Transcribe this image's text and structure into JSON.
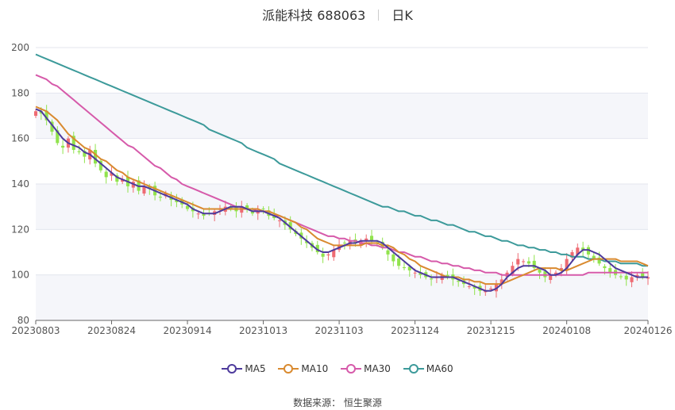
{
  "header": {
    "name_code": "派能科技 688063",
    "period": "日K"
  },
  "source": "数据来源：  恒生聚源",
  "colors": {
    "up": "#ee6b73",
    "down": "#91e34d",
    "MA5": "#4d3a9c",
    "MA10": "#d98a2f",
    "MA30": "#d65aaa",
    "MA60": "#3c9a9a"
  },
  "chart_data": {
    "type": "candlestick",
    "ylim": [
      80,
      200
    ],
    "yticks": [
      80,
      100,
      120,
      140,
      160,
      180,
      200
    ],
    "xticks": [
      "20230803",
      "20230824",
      "20230914",
      "20231013",
      "20231103",
      "20231124",
      "20231215",
      "20240108",
      "20240126"
    ],
    "xtick_index": [
      0,
      14,
      28,
      42,
      56,
      70,
      84,
      98,
      113
    ],
    "n_days": 114,
    "legend": [
      "MA5",
      "MA10",
      "MA30",
      "MA60"
    ],
    "close": [
      172,
      171,
      168,
      163,
      158,
      156,
      160,
      155,
      154,
      152,
      155,
      149,
      146,
      143,
      145,
      141,
      142,
      139,
      141,
      137,
      139,
      138,
      135,
      134,
      136,
      133,
      132,
      131,
      129,
      128,
      127,
      126,
      127,
      128,
      129,
      130,
      129,
      128,
      130,
      129,
      127,
      128,
      129,
      126,
      125,
      124,
      122,
      120,
      118,
      116,
      114,
      112,
      110,
      108,
      109,
      111,
      113,
      114,
      115,
      114,
      115,
      116,
      115,
      114,
      112,
      109,
      106,
      104,
      103,
      102,
      101,
      100,
      99,
      98,
      99,
      100,
      99,
      98,
      97,
      96,
      95,
      94,
      93,
      93,
      94,
      96,
      98,
      101,
      104,
      107,
      106,
      105,
      103,
      101,
      99,
      100,
      101,
      103,
      107,
      110,
      112,
      111,
      109,
      107,
      105,
      103,
      101,
      100,
      99,
      98,
      99,
      100,
      99,
      99
    ],
    "ma5": [
      173,
      172,
      169,
      166,
      163,
      160,
      158,
      157,
      156,
      154,
      153,
      151,
      149,
      147,
      145,
      143,
      142,
      141,
      140,
      139,
      139,
      138,
      137,
      136,
      135,
      134,
      133,
      132,
      131,
      129,
      128,
      127,
      127,
      127,
      128,
      129,
      130,
      130,
      130,
      129,
      128,
      128,
      128,
      127,
      126,
      125,
      123,
      121,
      119,
      117,
      115,
      113,
      111,
      110,
      110,
      111,
      112,
      113,
      114,
      114,
      115,
      115,
      115,
      115,
      114,
      112,
      110,
      108,
      106,
      104,
      102,
      101,
      100,
      99,
      99,
      99,
      99,
      99,
      98,
      97,
      96,
      95,
      94,
      93,
      93,
      94,
      96,
      99,
      101,
      103,
      104,
      104,
      104,
      103,
      102,
      100,
      100,
      101,
      103,
      106,
      109,
      111,
      111,
      110,
      109,
      107,
      105,
      103,
      102,
      101,
      100,
      99,
      99,
      99
    ],
    "ma10": [
      174,
      173,
      172,
      170,
      168,
      165,
      162,
      160,
      158,
      156,
      155,
      153,
      151,
      150,
      148,
      146,
      145,
      143,
      142,
      141,
      140,
      139,
      138,
      137,
      136,
      135,
      134,
      133,
      132,
      131,
      130,
      129,
      129,
      129,
      129,
      129,
      129,
      129,
      129,
      129,
      129,
      129,
      128,
      128,
      127,
      126,
      125,
      124,
      123,
      121,
      120,
      118,
      116,
      115,
      114,
      113,
      113,
      113,
      113,
      113,
      113,
      114,
      114,
      114,
      113,
      113,
      112,
      110,
      109,
      107,
      106,
      104,
      103,
      102,
      101,
      100,
      99,
      99,
      99,
      98,
      98,
      97,
      97,
      96,
      96,
      96,
      96,
      97,
      98,
      99,
      100,
      101,
      102,
      103,
      103,
      103,
      103,
      102,
      102,
      103,
      104,
      105,
      106,
      107,
      107,
      107,
      107,
      107,
      106,
      106,
      106,
      106,
      105,
      104
    ],
    "ma30": [
      188,
      187,
      186,
      184,
      183,
      181,
      179,
      177,
      175,
      173,
      171,
      169,
      167,
      165,
      163,
      161,
      159,
      157,
      156,
      154,
      152,
      150,
      148,
      147,
      145,
      143,
      142,
      140,
      139,
      138,
      137,
      136,
      135,
      134,
      133,
      132,
      131,
      130,
      130,
      129,
      129,
      128,
      128,
      127,
      126,
      126,
      125,
      124,
      123,
      122,
      121,
      120,
      119,
      118,
      117,
      117,
      116,
      116,
      115,
      115,
      114,
      114,
      113,
      113,
      112,
      112,
      111,
      110,
      110,
      109,
      108,
      108,
      107,
      106,
      106,
      105,
      105,
      104,
      104,
      103,
      103,
      102,
      102,
      101,
      101,
      101,
      100,
      100,
      100,
      100,
      100,
      100,
      100,
      100,
      100,
      100,
      100,
      100,
      100,
      100,
      100,
      100,
      101,
      101,
      101,
      101,
      101,
      101,
      101,
      101,
      101,
      101,
      101,
      101
    ],
    "ma60": [
      197,
      196,
      195,
      194,
      193,
      192,
      191,
      190,
      189,
      188,
      187,
      186,
      185,
      184,
      183,
      182,
      181,
      180,
      179,
      178,
      177,
      176,
      175,
      174,
      173,
      172,
      171,
      170,
      169,
      168,
      167,
      166,
      164,
      163,
      162,
      161,
      160,
      159,
      158,
      156,
      155,
      154,
      153,
      152,
      151,
      149,
      148,
      147,
      146,
      145,
      144,
      143,
      142,
      141,
      140,
      139,
      138,
      137,
      136,
      135,
      134,
      133,
      132,
      131,
      130,
      130,
      129,
      128,
      128,
      127,
      126,
      126,
      125,
      124,
      124,
      123,
      122,
      122,
      121,
      120,
      119,
      119,
      118,
      117,
      117,
      116,
      115,
      115,
      114,
      113,
      113,
      112,
      112,
      111,
      111,
      110,
      110,
      109,
      109,
      108,
      108,
      108,
      107,
      107,
      107,
      106,
      106,
      106,
      105,
      105,
      105,
      105,
      104,
      104
    ]
  }
}
